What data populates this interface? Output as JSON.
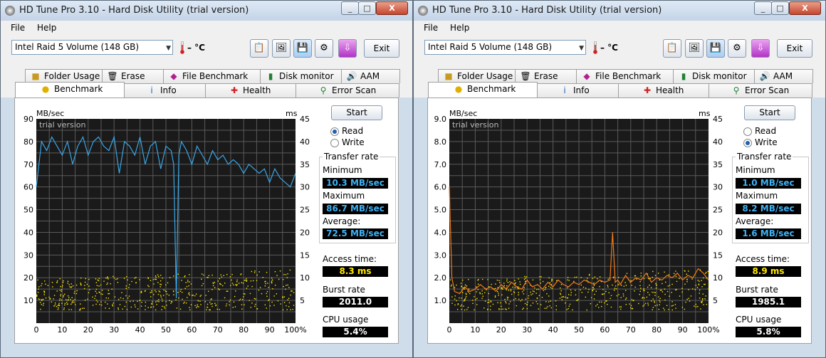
{
  "windows": [
    {
      "title": "HD Tune Pro 3.10 - Hard Disk Utility (trial version)",
      "menu": [
        "File",
        "Help"
      ],
      "drive": "Intel   Raid 5 Volume (148 GB)",
      "temperature": "– °C",
      "exit_label": "Exit",
      "tabs_row1": [
        "Folder Usage",
        "Erase",
        "File Benchmark",
        "Disk monitor",
        "AAM"
      ],
      "tabs_row2": [
        "Benchmark",
        "Info",
        "Health",
        "Error Scan"
      ],
      "selected_tab": "Benchmark",
      "start_label": "Start",
      "mode": "Read",
      "radio_labels": [
        "Read",
        "Write"
      ],
      "transfer_rate_label": "Transfer rate",
      "minimum_label": "Minimum",
      "minimum": "10.3 MB/sec",
      "maximum_label": "Maximum",
      "maximum": "86.7 MB/sec",
      "average_label": "Average:",
      "average": "72.5 MB/sec",
      "access_time_label": "Access time:",
      "access_time": "8.3 ms",
      "burst_rate_label": "Burst rate",
      "burst_rate": "2011.0 MB/sec",
      "cpu_usage_label": "CPU usage",
      "cpu_usage": "5.4%",
      "chart_data": {
        "type": "line",
        "watermark": "trial version",
        "left_axis_unit": "MB/sec",
        "right_axis_unit": "ms",
        "left_ticks": [
          "10",
          "20",
          "30",
          "40",
          "50",
          "60",
          "70",
          "80",
          "90"
        ],
        "right_ticks": [
          "5",
          "10",
          "15",
          "20",
          "25",
          "30",
          "35",
          "40",
          "45"
        ],
        "x_ticks": [
          "0",
          "10",
          "20",
          "30",
          "40",
          "50",
          "60",
          "70",
          "80",
          "90",
          "100%"
        ],
        "ylim": [
          0,
          90
        ],
        "y2lim": [
          0,
          45
        ],
        "xlim": [
          0,
          100
        ],
        "line_color": "#3aa6e6",
        "series": [
          {
            "x": [
              0,
              2,
              4,
              6,
              8,
              10,
              12,
              14,
              16,
              18,
              20,
              22,
              24,
              26,
              28,
              30,
              32,
              34,
              36,
              38,
              40,
              42,
              44,
              46,
              48,
              50,
              52,
              53,
              54,
              55,
              56,
              58,
              60,
              62,
              64,
              66,
              68,
              70,
              72,
              74,
              76,
              78,
              80,
              82,
              84,
              86,
              88,
              90,
              92,
              94,
              96,
              98,
              100
            ],
            "values": [
              60,
              80,
              76,
              82,
              78,
              74,
              80,
              70,
              78,
              82,
              74,
              80,
              82,
              78,
              76,
              82,
              66,
              80,
              78,
              74,
              82,
              70,
              78,
              80,
              68,
              78,
              76,
              70,
              11,
              74,
              80,
              76,
              70,
              78,
              74,
              70,
              76,
              72,
              74,
              70,
              72,
              70,
              66,
              70,
              68,
              66,
              68,
              62,
              68,
              64,
              62,
              60,
              66
            ]
          }
        ],
        "access_points": {
          "color": "#ffe800",
          "y_range_ms": [
            3,
            12
          ]
        }
      }
    },
    {
      "title": "HD Tune Pro 3.10 - Hard Disk Utility (trial version)",
      "menu": [
        "File",
        "Help"
      ],
      "drive": "Intel   Raid 5 Volume (148 GB)",
      "temperature": "– °C",
      "exit_label": "Exit",
      "tabs_row1": [
        "Folder Usage",
        "Erase",
        "File Benchmark",
        "Disk monitor",
        "AAM"
      ],
      "tabs_row2": [
        "Benchmark",
        "Info",
        "Health",
        "Error Scan"
      ],
      "selected_tab": "Benchmark",
      "start_label": "Start",
      "mode": "Write",
      "radio_labels": [
        "Read",
        "Write"
      ],
      "transfer_rate_label": "Transfer rate",
      "minimum_label": "Minimum",
      "minimum": "1.0 MB/sec",
      "maximum_label": "Maximum",
      "maximum": "8.2 MB/sec",
      "average_label": "Average:",
      "average": "1.6 MB/sec",
      "access_time_label": "Access time:",
      "access_time": "8.9 ms",
      "burst_rate_label": "Burst rate",
      "burst_rate": "1985.1 MB/sec",
      "cpu_usage_label": "CPU usage",
      "cpu_usage": "5.8%",
      "chart_data": {
        "type": "line",
        "watermark": "trial version",
        "left_axis_unit": "MB/sec",
        "right_axis_unit": "ms",
        "left_ticks": [
          "1.0",
          "2.0",
          "3.0",
          "4.0",
          "5.0",
          "6.0",
          "7.0",
          "8.0",
          "9.0"
        ],
        "right_ticks": [
          "5",
          "10",
          "15",
          "20",
          "25",
          "30",
          "35",
          "40",
          "45"
        ],
        "x_ticks": [
          "0",
          "10",
          "20",
          "30",
          "40",
          "50",
          "60",
          "70",
          "80",
          "90",
          "100%"
        ],
        "ylim": [
          0,
          9
        ],
        "y2lim": [
          0,
          45
        ],
        "xlim": [
          0,
          100
        ],
        "line_color": "#f07a1a",
        "series": [
          {
            "x": [
              0,
              1,
              2,
              4,
              6,
              8,
              10,
              12,
              14,
              16,
              18,
              20,
              22,
              24,
              26,
              28,
              30,
              32,
              34,
              36,
              38,
              40,
              42,
              44,
              46,
              48,
              50,
              52,
              54,
              56,
              58,
              60,
              62,
              63,
              64,
              65,
              66,
              68,
              70,
              72,
              74,
              76,
              78,
              80,
              82,
              84,
              86,
              88,
              90,
              92,
              94,
              96,
              98,
              100
            ],
            "values": [
              6.0,
              2.0,
              1.4,
              1.3,
              1.6,
              1.4,
              1.5,
              1.7,
              1.5,
              1.6,
              1.4,
              1.7,
              1.5,
              1.8,
              1.6,
              1.5,
              1.9,
              1.6,
              1.7,
              1.5,
              1.8,
              1.6,
              1.9,
              1.7,
              1.6,
              1.8,
              1.7,
              1.9,
              1.8,
              1.7,
              1.9,
              1.8,
              1.9,
              4.0,
              1.8,
              1.9,
              1.7,
              2.1,
              1.8,
              2.0,
              1.9,
              2.2,
              1.8,
              2.0,
              1.9,
              2.1,
              2.0,
              2.2,
              1.9,
              2.1,
              2.0,
              2.4,
              2.2,
              1.9
            ]
          }
        ],
        "access_points": {
          "color": "#ffe800",
          "y_range_ms": [
            3,
            12
          ]
        }
      }
    }
  ]
}
